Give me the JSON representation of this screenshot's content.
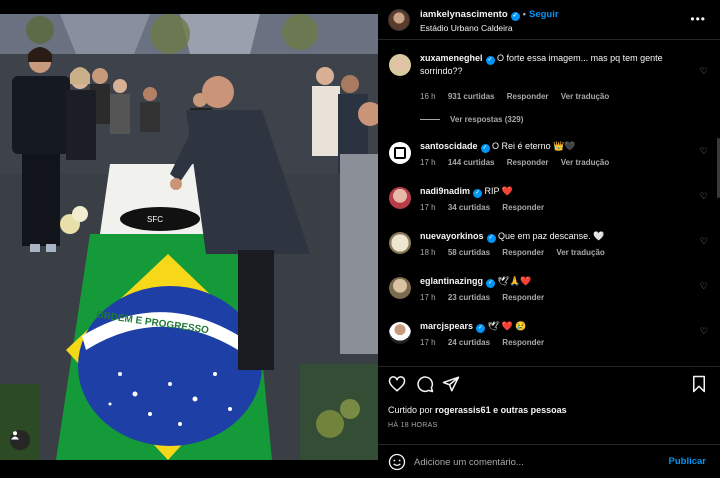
{
  "post": {
    "username": "iamkelynascimento",
    "follow_label": "Seguir",
    "location": "Estádio Urbano Caldeira",
    "flag_motto": "ORDEM E PROGRESSO"
  },
  "comments": [
    {
      "username": "xuxameneghel",
      "text": "O forte essa imagem... mas pq tem gente sorrindo??",
      "time": "16 h",
      "likes": "931 curtidas",
      "reply": "Responder",
      "translate": "Ver tradução",
      "view_replies": "Ver respostas (329)"
    },
    {
      "username": "santoscidade",
      "text": "O Rei é eterno 👑🖤",
      "time": "17 h",
      "likes": "144 curtidas",
      "reply": "Responder",
      "translate": "Ver tradução"
    },
    {
      "username": "nadi9nadim",
      "text": "RIP ❤️",
      "time": "17 h",
      "likes": "34 curtidas",
      "reply": "Responder"
    },
    {
      "username": "nuevayorkinos",
      "text": "Que em paz descanse. 🤍",
      "time": "18 h",
      "likes": "58 curtidas",
      "reply": "Responder",
      "translate": "Ver tradução"
    },
    {
      "username": "eglantinazingg",
      "text": "🕊🙏❤️",
      "time": "17 h",
      "likes": "23 curtidas",
      "reply": "Responder"
    },
    {
      "username": "marcjspears",
      "text": "🕊 ❤️ 😢",
      "time": "17 h",
      "likes": "24 curtidas",
      "reply": "Responder"
    }
  ],
  "footer": {
    "liked_by_prefix": "Curtido por ",
    "liked_by_user": "rogerassis61",
    "liked_by_suffix": " e outras pessoas",
    "posted_ago": "HÁ 18 HORAS",
    "comment_placeholder": "Adicione um comentário...",
    "publish_label": "Publicar"
  },
  "icons": {
    "verified": "verified-badge-icon",
    "more": "more-options-icon",
    "heart": "heart-icon",
    "comment": "comment-icon",
    "share": "share-icon",
    "save": "bookmark-icon",
    "emoji": "emoji-icon",
    "user_tag": "user-tag-icon"
  },
  "colors": {
    "accent": "#0095f6",
    "background": "#000000",
    "muted_text": "#a8a8a8"
  }
}
